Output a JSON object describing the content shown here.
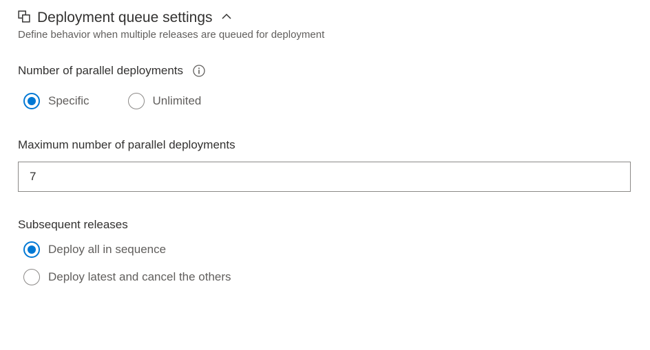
{
  "section": {
    "title": "Deployment queue settings",
    "subtitle": "Define behavior when multiple releases are queued for deployment"
  },
  "parallel": {
    "label": "Number of parallel deployments",
    "options": {
      "specific": "Specific",
      "unlimited": "Unlimited"
    },
    "selected": "specific"
  },
  "max": {
    "label": "Maximum number of parallel deployments",
    "value": "7"
  },
  "subsequent": {
    "label": "Subsequent releases",
    "options": {
      "sequence": "Deploy all in sequence",
      "latest": "Deploy latest and cancel the others"
    },
    "selected": "sequence"
  }
}
